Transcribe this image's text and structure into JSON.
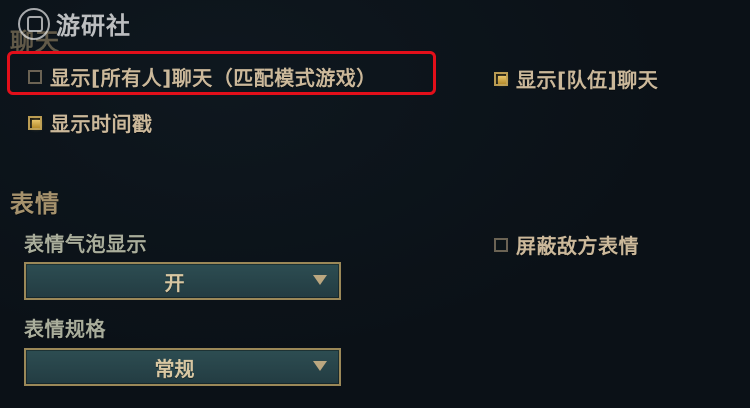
{
  "watermark": {
    "text": "游研社"
  },
  "chat": {
    "section_title": "聊天",
    "options": [
      {
        "label": "显示[所有人]聊天（匹配模式游戏）",
        "checked": false,
        "highlighted": true
      },
      {
        "label": "显示[队伍]聊天",
        "checked": true
      },
      {
        "label": "显示时间戳",
        "checked": true
      }
    ]
  },
  "emotes": {
    "section_title": "表情",
    "bubble_label": "表情气泡显示",
    "bubble_value": "开",
    "size_label": "表情规格",
    "size_value": "常规",
    "mute_enemy_label": "屏蔽敌方表情",
    "mute_enemy_checked": false
  },
  "colors": {
    "accent_gold": "#b99b53",
    "highlight_red": "#e30f1a",
    "text_tan": "#cbb89a",
    "dropdown_teal": "#2d4d52"
  },
  "icons": {
    "chevron": "chevron-down-icon",
    "watermark_logo": "watermark-logo-icon"
  }
}
